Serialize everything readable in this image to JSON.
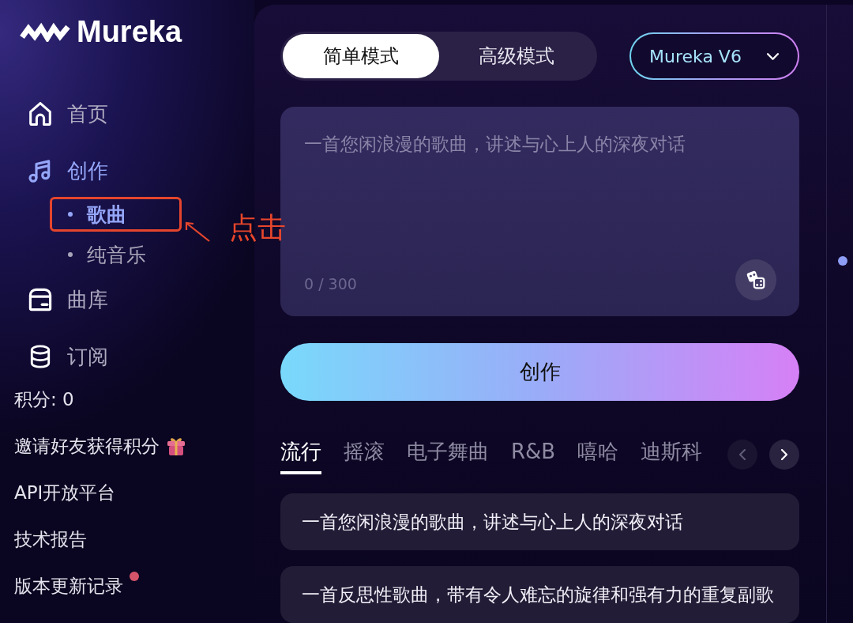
{
  "brand": {
    "name": "Mureka"
  },
  "nav": [
    {
      "label": "首页",
      "kind": "home",
      "selected": false
    },
    {
      "label": "创作",
      "kind": "create",
      "selected": true,
      "children": [
        {
          "label": "歌曲",
          "selected": true,
          "annotated": true
        },
        {
          "label": "纯音乐",
          "selected": false,
          "annotated": false
        }
      ]
    },
    {
      "label": "曲库",
      "kind": "library",
      "selected": false
    },
    {
      "label": "订阅",
      "kind": "subscribe",
      "selected": false
    }
  ],
  "annotation": {
    "label": "点击"
  },
  "points": "积分: 0",
  "links": [
    {
      "label": "邀请好友获得积分",
      "kind": "gift",
      "badge": false
    },
    {
      "label": "API开放平台",
      "kind": "text",
      "badge": false
    },
    {
      "label": "技术报告",
      "kind": "text",
      "badge": false
    },
    {
      "label": "版本更新记录",
      "kind": "text",
      "badge": true
    }
  ],
  "mode_tabs": [
    {
      "label": "简单模式",
      "selected": true
    },
    {
      "label": "高级模式",
      "selected": false
    }
  ],
  "model_select": {
    "value": "Mureka V6"
  },
  "prompt": {
    "placeholder": "一首您闲浪漫的歌曲，讲述与心上人的深夜对话",
    "counter": "0 / 300"
  },
  "create_button": {
    "label": "创作"
  },
  "genre_tabs": [
    {
      "label": "流行",
      "selected": true
    },
    {
      "label": "摇滚",
      "selected": false
    },
    {
      "label": "电子舞曲",
      "selected": false
    },
    {
      "label": "R&B",
      "selected": false
    },
    {
      "label": "嘻哈",
      "selected": false
    },
    {
      "label": "迪斯科",
      "selected": false
    }
  ],
  "genre_nav": [
    {
      "kind": "prev",
      "disabled": true
    },
    {
      "kind": "next",
      "disabled": false
    }
  ],
  "examples": [
    "一首您闲浪漫的歌曲，讲述与心上人的深夜对话",
    "一首反思性歌曲，带有令人难忘的旋律和强有力的重复副歌"
  ]
}
